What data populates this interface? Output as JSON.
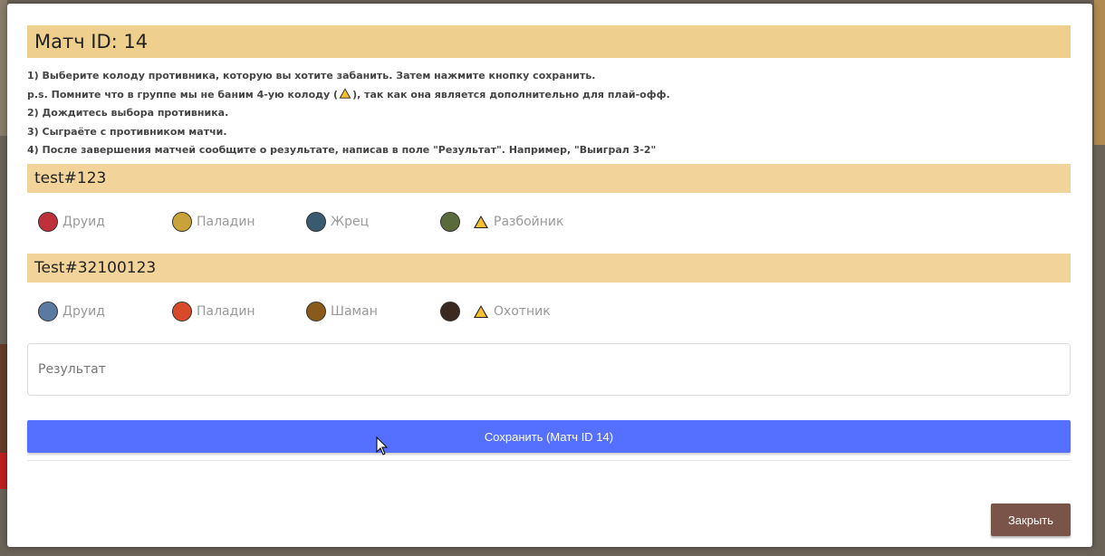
{
  "modal": {
    "title": "Матч ID: 14",
    "instructions": [
      "1) Выберите колоду противника, которую вы хотите забанить. Затем нажмите кнопку сохранить.",
      "p.s. Помните что в группе мы не баним 4-ую колоду (",
      "), так как она является дополнительно для плай-офф.",
      "2) Дождитесь выбора противника.",
      "3) Сыграёте с противником матчи.",
      "4) После завершения матчей сообщите о результате, написав в поле \"Результат\". Например, \"Выиграл 3-2\""
    ],
    "players": [
      {
        "name": "test#123",
        "decks": [
          {
            "label": "Друид",
            "icon": "druid-icon",
            "color": "#c0303a"
          },
          {
            "label": "Паладин",
            "icon": "paladin-icon",
            "color": "#c9a23a"
          },
          {
            "label": "Жрец",
            "icon": "priest-icon",
            "color": "#3a5a70"
          },
          {
            "label": "Разбойник",
            "icon": "rogue-icon",
            "color": "#5a6a3a"
          }
        ]
      },
      {
        "name": "Test#32100123",
        "decks": [
          {
            "label": "Друид",
            "icon": "druid-icon",
            "color": "#5a7aa0"
          },
          {
            "label": "Паладин",
            "icon": "paladin-icon",
            "color": "#d84a2a"
          },
          {
            "label": "Шаман",
            "icon": "shaman-icon",
            "color": "#8a5a1a"
          },
          {
            "label": "Охотник",
            "icon": "hunter-icon",
            "color": "#3a2a20"
          }
        ]
      }
    ],
    "result_placeholder": "Результат",
    "save_label": "Сохранить (Матч ID 14)",
    "close_label": "Закрыть"
  }
}
